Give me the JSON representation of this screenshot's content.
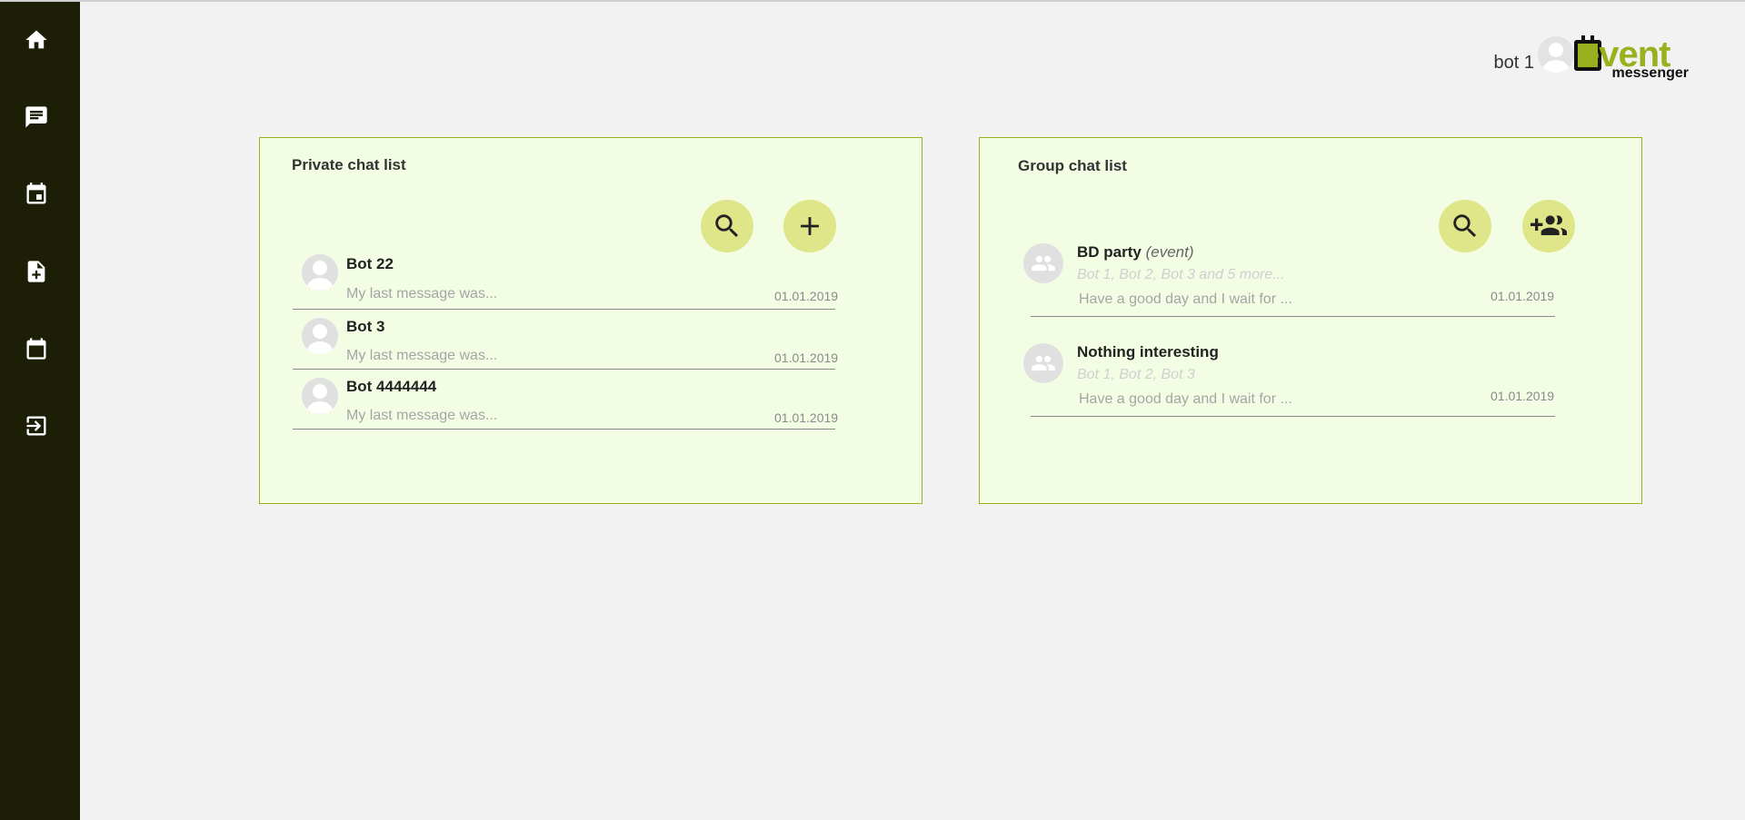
{
  "header": {
    "user_name": "bot 1",
    "logo": {
      "word": "event",
      "sub": "messenger"
    }
  },
  "sidebar": {
    "items": [
      {
        "icon": "home-icon"
      },
      {
        "icon": "chat-icon"
      },
      {
        "icon": "event-icon"
      },
      {
        "icon": "add-document-icon"
      },
      {
        "icon": "calendar-icon"
      },
      {
        "icon": "logout-icon"
      }
    ]
  },
  "private_panel": {
    "title": "Private chat list",
    "chats": [
      {
        "name": "Bot 22",
        "last_message": "My last message was...",
        "date": "01.01.2019"
      },
      {
        "name": "Bot 3",
        "last_message": "My last message was...",
        "date": "01.01.2019"
      },
      {
        "name": "Bot 4444444",
        "last_message": "My last message was...",
        "date": "01.01.2019"
      }
    ]
  },
  "group_panel": {
    "title": "Group chat list",
    "chats": [
      {
        "name": "BD party",
        "tag": "(event)",
        "members": "Bot 1, Bot 2, Bot 3 and 5 more...",
        "last_message": "Have a good day and I wait for ...",
        "date": "01.01.2019"
      },
      {
        "name": "Nothing interesting",
        "members": "Bot 1, Bot 2, Bot 3",
        "last_message": "Have a good day and I wait for ...",
        "date": "01.01.2019"
      }
    ]
  },
  "colors": {
    "sidebar_bg": "#1c1e06",
    "accent": "#9ab11f",
    "panel_bg": "#f3fde4",
    "button_bg": "#dfe68a"
  }
}
